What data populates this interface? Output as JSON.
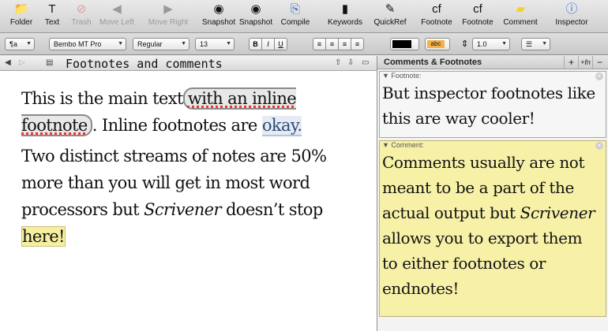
{
  "toolbar": {
    "items": [
      {
        "label": "Folder",
        "icon": "folder-icon",
        "enabled": true
      },
      {
        "label": "Text",
        "icon": "text-document-icon",
        "enabled": true
      },
      {
        "label": "Trash",
        "icon": "trash-icon",
        "enabled": false
      },
      {
        "label": "Move Left",
        "icon": "move-left-icon",
        "enabled": false
      },
      {
        "label": "Move Right",
        "icon": "move-right-icon",
        "enabled": false
      },
      {
        "label": "Snapshot",
        "icon": "camera-icon",
        "enabled": true
      },
      {
        "label": "Snapshot",
        "icon": "camera-compare-icon",
        "enabled": true
      },
      {
        "label": "Compile",
        "icon": "compile-icon",
        "enabled": true
      },
      {
        "label": "Keywords",
        "icon": "keywords-icon",
        "enabled": true
      },
      {
        "label": "QuickRef",
        "icon": "quickref-icon",
        "enabled": true
      },
      {
        "label": "Footnote",
        "icon": "footnote-icon",
        "enabled": true
      },
      {
        "label": "Footnote",
        "icon": "inspector-footnote-icon",
        "enabled": true
      },
      {
        "label": "Comment",
        "icon": "comment-icon",
        "enabled": true
      },
      {
        "label": "Inspector",
        "icon": "inspector-icon",
        "enabled": true
      }
    ]
  },
  "formatbar": {
    "style": "¶a",
    "font_family": "Bembo MT Pro",
    "font_style": "Regular",
    "font_size": "13",
    "bold": "B",
    "italic": "I",
    "underline": "U",
    "text_color": "#000000",
    "highlight_label": "abc",
    "highlight_color": "#f5b24a",
    "line_spacing": "1.0"
  },
  "editor": {
    "title": "Footnotes and comments",
    "p1_a": "This is the main text",
    "p1_inline": "with an inline footnote",
    "p1_b": ". Inline footnotes are ",
    "p1_anchor": "okay.",
    "p2_a": "Two distinct streams of notes are 50% more than you will get in most word processors but ",
    "p2_italic": "Scrivener",
    "p2_b": " doesn’t stop ",
    "p2_anchor": "here!"
  },
  "inspector": {
    "title": "Comments & Footnotes",
    "add_label": "+",
    "fn_label": "+fn",
    "footnote": {
      "label": "Footnote:",
      "text": "But inspector footnotes like this are way cooler!"
    },
    "comment": {
      "label": "Comment:",
      "text_a": "Comments usually are not meant to be a part of the actual output but ",
      "text_italic": "Scrivener",
      "text_b": " allows you to export them to either footnotes or endnotes!"
    }
  }
}
